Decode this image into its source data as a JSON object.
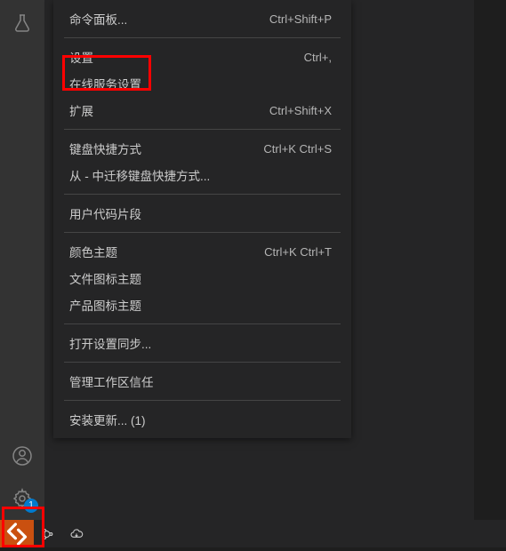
{
  "menu": {
    "groups": [
      [
        {
          "label": "命令面板...",
          "shortcut": "Ctrl+Shift+P"
        }
      ],
      [
        {
          "label": "设置",
          "shortcut": "Ctrl+,"
        },
        {
          "label": "在线服务设置",
          "shortcut": ""
        },
        {
          "label": "扩展",
          "shortcut": "Ctrl+Shift+X"
        }
      ],
      [
        {
          "label": "键盘快捷方式",
          "shortcut": "Ctrl+K Ctrl+S"
        },
        {
          "label": "从 - 中迁移键盘快捷方式...",
          "shortcut": ""
        }
      ],
      [
        {
          "label": "用户代码片段",
          "shortcut": ""
        }
      ],
      [
        {
          "label": "颜色主题",
          "shortcut": "Ctrl+K Ctrl+T"
        },
        {
          "label": "文件图标主题",
          "shortcut": ""
        },
        {
          "label": "产品图标主题",
          "shortcut": ""
        }
      ],
      [
        {
          "label": "打开设置同步...",
          "shortcut": ""
        }
      ],
      [
        {
          "label": "管理工作区信任",
          "shortcut": ""
        }
      ],
      [
        {
          "label": "安装更新... (1)",
          "shortcut": ""
        }
      ]
    ]
  },
  "activity_bar": {
    "settings_badge": "1"
  },
  "colors": {
    "highlight": "#ff0000",
    "status_remote_bg": "#ca5010",
    "badge_bg": "#007acc"
  }
}
